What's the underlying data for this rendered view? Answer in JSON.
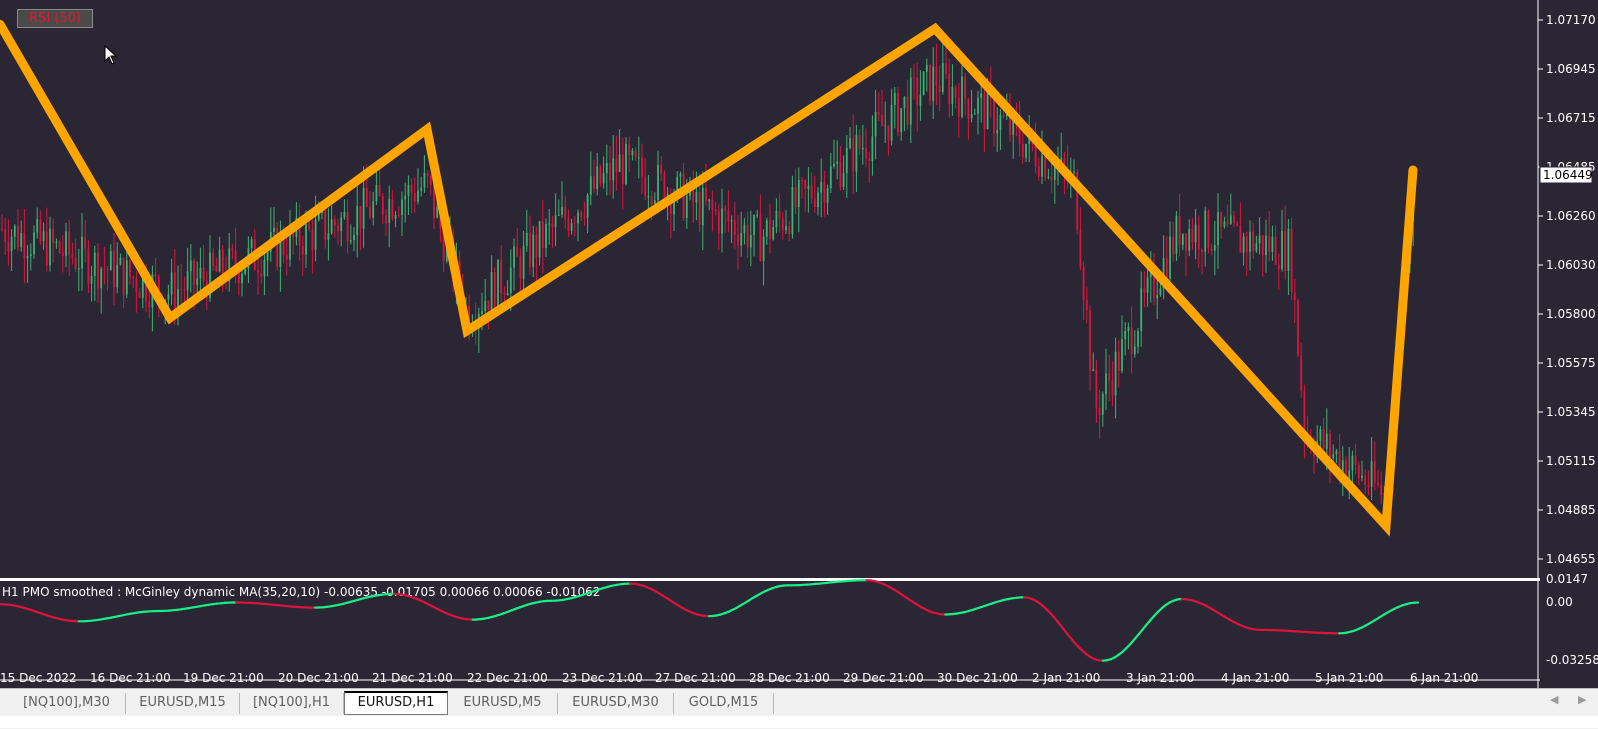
{
  "rsi_button": {
    "label": "RSI (50)"
  },
  "price_axis": {
    "labels": [
      "1.07170",
      "1.06945",
      "1.06715",
      "1.06485",
      "1.06260",
      "1.06030",
      "1.05800",
      "1.05575",
      "1.05345",
      "1.05115",
      "1.04885",
      "1.04655"
    ],
    "current_price": "1.06449"
  },
  "indicator": {
    "title": "H1 PMO smoothed :  McGinley dynamic MA(35,20,10) -0.00635 -0.01705 0.00066 0.00066 -0.01062",
    "axis_labels": [
      "0.0147",
      "0.00",
      "-0.03258"
    ]
  },
  "time_axis": {
    "labels": [
      "15 Dec 2022",
      "16 Dec 21:00",
      "19 Dec 21:00",
      "20 Dec 21:00",
      "21 Dec 21:00",
      "22 Dec 21:00",
      "23 Dec 21:00",
      "27 Dec 21:00",
      "28 Dec 21:00",
      "29 Dec 21:00",
      "30 Dec 21:00",
      "2 Jan 21:00",
      "3 Jan 21:00",
      "4 Jan 21:00",
      "5 Jan 21:00",
      "6 Jan 21:00"
    ]
  },
  "tabs": [
    {
      "label": "[NQ100],M30"
    },
    {
      "label": "EURUSD,M15"
    },
    {
      "label": "[NQ100],H1"
    },
    {
      "label": "EURUSD,H1"
    },
    {
      "label": "EURUSD,M5"
    },
    {
      "label": "EURUSD,M30"
    },
    {
      "label": "GOLD,M15"
    }
  ],
  "colors": {
    "background": "#2a2634",
    "zigzag": "#ffa500",
    "bull": "#3cb371",
    "bear": "#dc143c",
    "pmo_up": "#1aef86",
    "pmo_down": "#dc143c"
  },
  "chart_data": {
    "type": "line",
    "symbol": "EURUSD",
    "timeframe": "H1",
    "y_range": [
      1.04655,
      1.0718
    ],
    "zigzag_pivots": [
      {
        "x": "15 Dec",
        "y": 1.0715
      },
      {
        "x": "19 Dec",
        "y": 1.0578
      },
      {
        "x": "21 Dec",
        "y": 1.0666
      },
      {
        "x": "22 Dec",
        "y": 1.0572
      },
      {
        "x": "30 Dec",
        "y": 1.0713
      },
      {
        "x": "5 Jan",
        "y": 1.0481
      },
      {
        "x": "6 Jan",
        "y": 1.0647
      }
    ],
    "indicator_series": {
      "name": "H1 PMO smoothed",
      "y_range": [
        -0.03258,
        0.0147
      ],
      "values": [
        0.0,
        -0.01,
        -0.004,
        0.001,
        -0.002,
        0.006,
        -0.009,
        0.002,
        0.012,
        -0.007,
        0.011,
        0.014,
        -0.006,
        0.004,
        -0.033,
        0.003,
        -0.015,
        -0.017,
        0.001
      ]
    }
  }
}
